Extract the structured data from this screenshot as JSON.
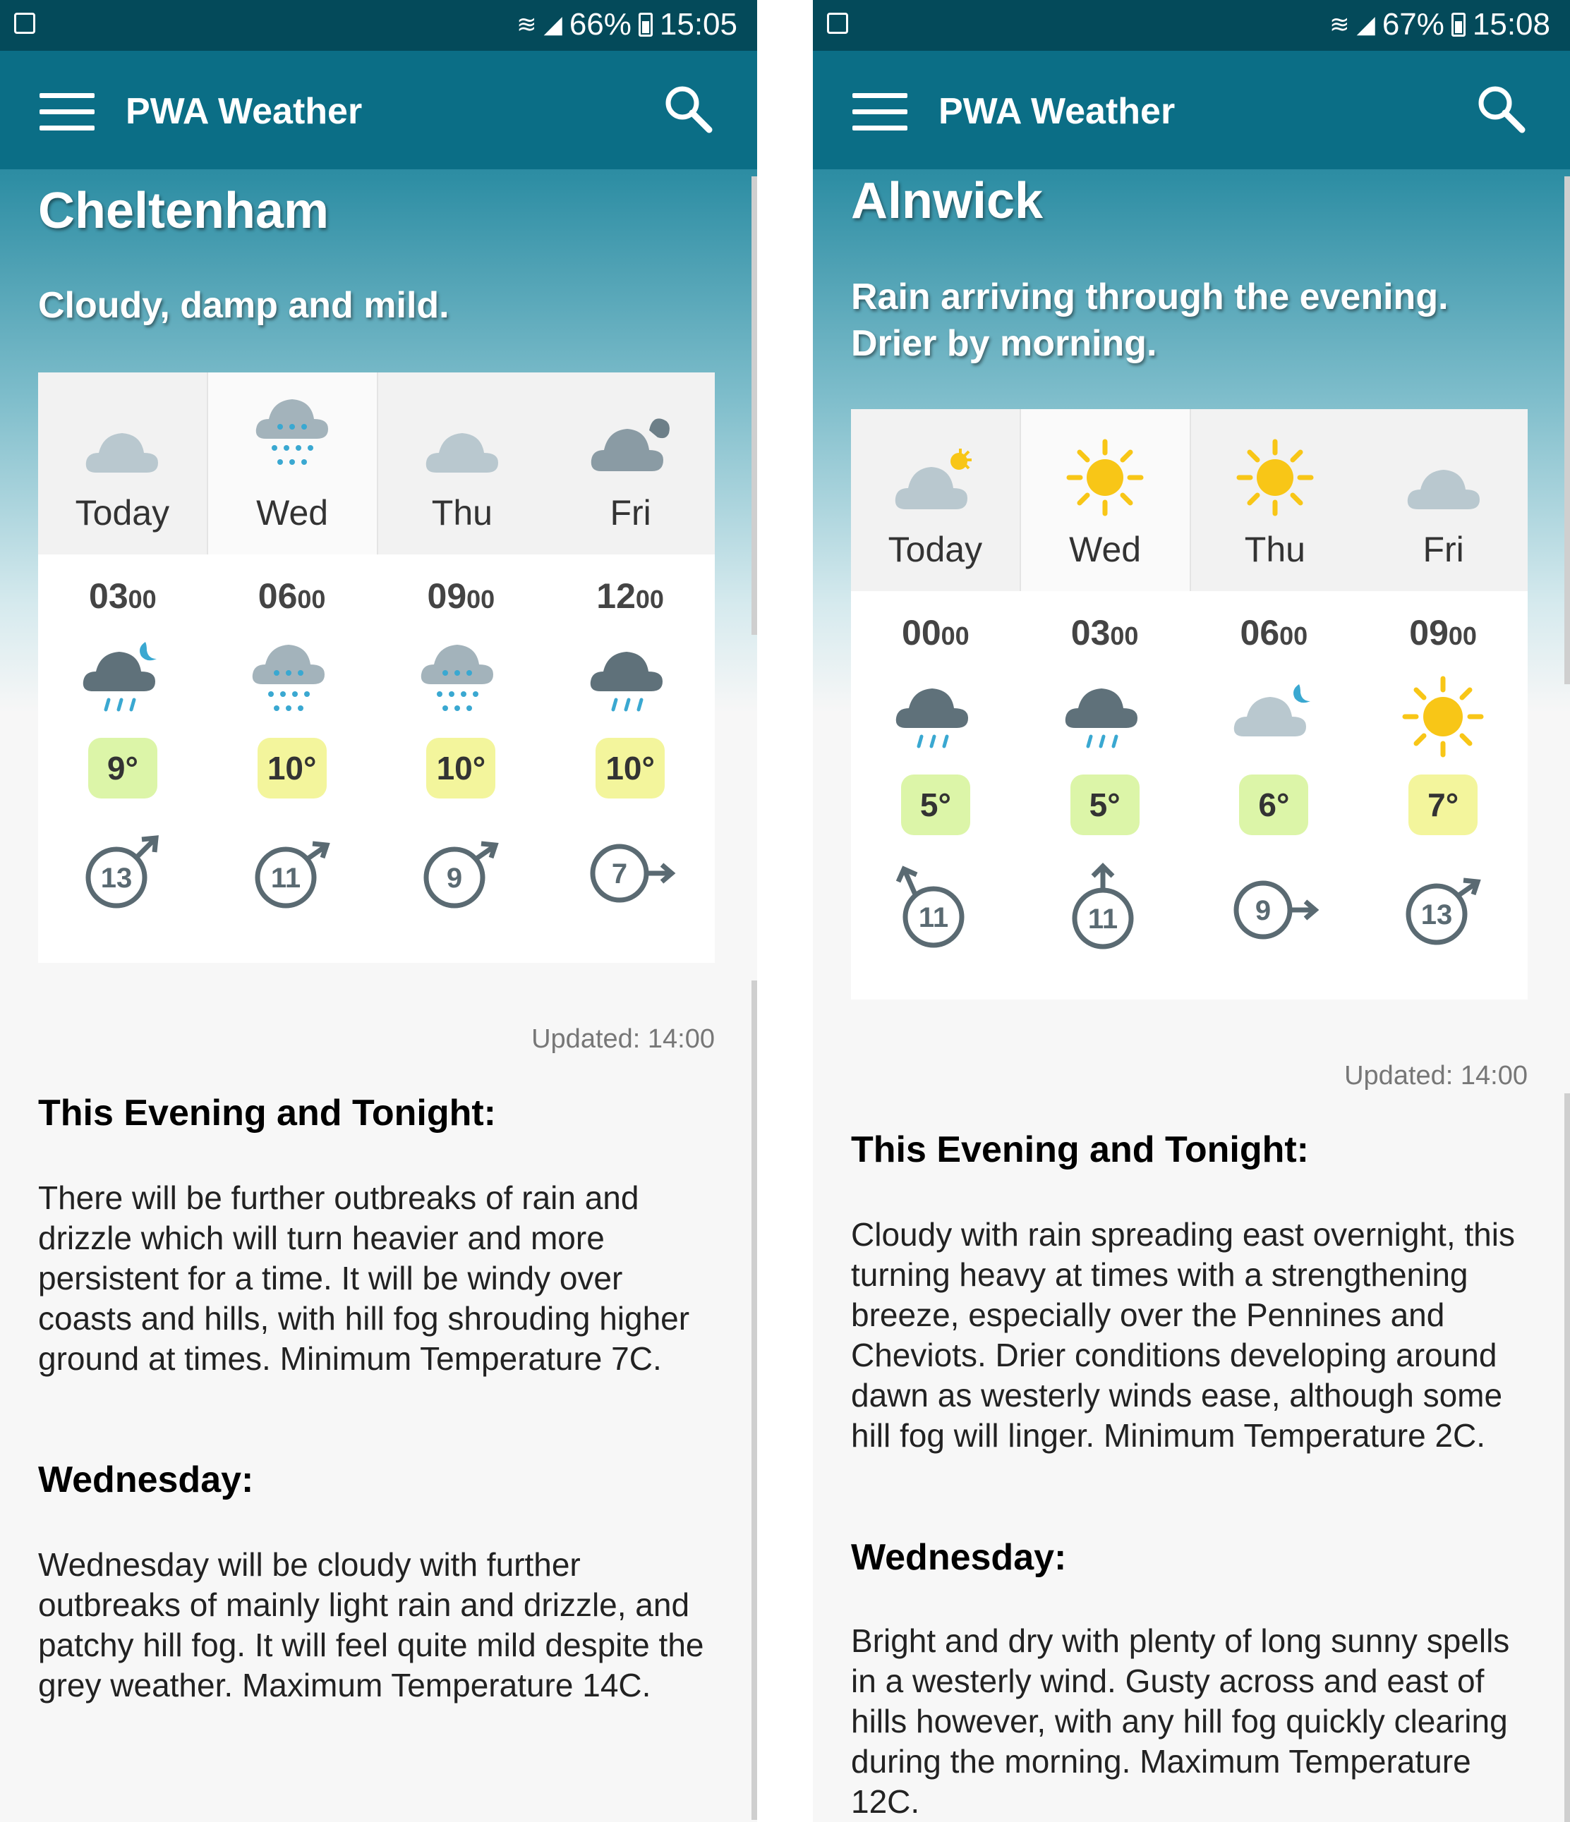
{
  "colors": {
    "status_bar": "#044a5a",
    "app_bar": "#0b6e86",
    "temp_green": "#dcf5a8",
    "temp_yellow": "#f3f59c",
    "rain": "#3aa8d1",
    "sun": "#f8c617"
  },
  "screens": [
    {
      "status": {
        "battery": "66%",
        "time": "15:05"
      },
      "app_title": "PWA Weather",
      "city": "Cheltenham",
      "summary": "Cloudy, damp and mild.",
      "days": [
        {
          "label": "Today",
          "icon": "cloud-icon"
        },
        {
          "label": "Wed",
          "icon": "rain-cloud-icon"
        },
        {
          "label": "Thu",
          "icon": "cloud-icon"
        },
        {
          "label": "Fri",
          "icon": "dark-cloud-icon"
        }
      ],
      "hours": [
        {
          "hh": "03",
          "mm": "00",
          "icon": "night-rain-icon",
          "temp": "9°",
          "wind": "13"
        },
        {
          "hh": "06",
          "mm": "00",
          "icon": "drizzle-icon",
          "temp": "10°",
          "wind": "11"
        },
        {
          "hh": "09",
          "mm": "00",
          "icon": "drizzle-icon",
          "temp": "10°",
          "wind": "9"
        },
        {
          "hh": "12",
          "mm": "00",
          "icon": "rain-icon",
          "temp": "10°",
          "wind": "7"
        }
      ],
      "updated": "Updated: 14:00",
      "sections": [
        {
          "heading": "This Evening and Tonight:",
          "body": "There will be further outbreaks of rain and drizzle which will turn heavier and more persistent for a time. It will be windy over coasts and hills, with hill fog shrouding higher ground at times. Minimum Temperature 7C."
        },
        {
          "heading": "Wednesday:",
          "body": "Wednesday will be cloudy with further outbreaks of mainly light rain and drizzle, and patchy hill fog. It will feel quite mild despite the grey weather. Maximum Temperature 14C."
        }
      ]
    },
    {
      "status": {
        "battery": "67%",
        "time": "15:08"
      },
      "app_title": "PWA Weather",
      "city": "Alnwick",
      "summary": "Rain arriving through the evening. Drier by morning.",
      "days": [
        {
          "label": "Today",
          "icon": "sun-cloud-icon"
        },
        {
          "label": "Wed",
          "icon": "sun-icon"
        },
        {
          "label": "Thu",
          "icon": "sun-icon"
        },
        {
          "label": "Fri",
          "icon": "cloud-icon"
        }
      ],
      "hours": [
        {
          "hh": "00",
          "mm": "00",
          "icon": "rain-icon",
          "temp": "5°",
          "wind": "11"
        },
        {
          "hh": "03",
          "mm": "00",
          "icon": "rain-icon",
          "temp": "5°",
          "wind": "11"
        },
        {
          "hh": "06",
          "mm": "00",
          "icon": "night-cloud-icon",
          "temp": "6°",
          "wind": "9"
        },
        {
          "hh": "09",
          "mm": "00",
          "icon": "sun-icon",
          "temp": "7°",
          "wind": "13"
        }
      ],
      "updated": "Updated: 14:00",
      "sections": [
        {
          "heading": "This Evening and Tonight:",
          "body": "Cloudy with rain spreading east overnight, this turning heavy at times with a strengthening breeze, especially over the Pennines and Cheviots. Drier conditions developing around dawn as westerly winds ease, although some hill fog will linger. Minimum Temperature 2C."
        },
        {
          "heading": "Wednesday:",
          "body": "Bright and dry with plenty of long sunny spells in a westerly wind. Gusty across and east of hills however, with any hill fog quickly clearing during the morning. Maximum Temperature 12C."
        }
      ]
    }
  ]
}
